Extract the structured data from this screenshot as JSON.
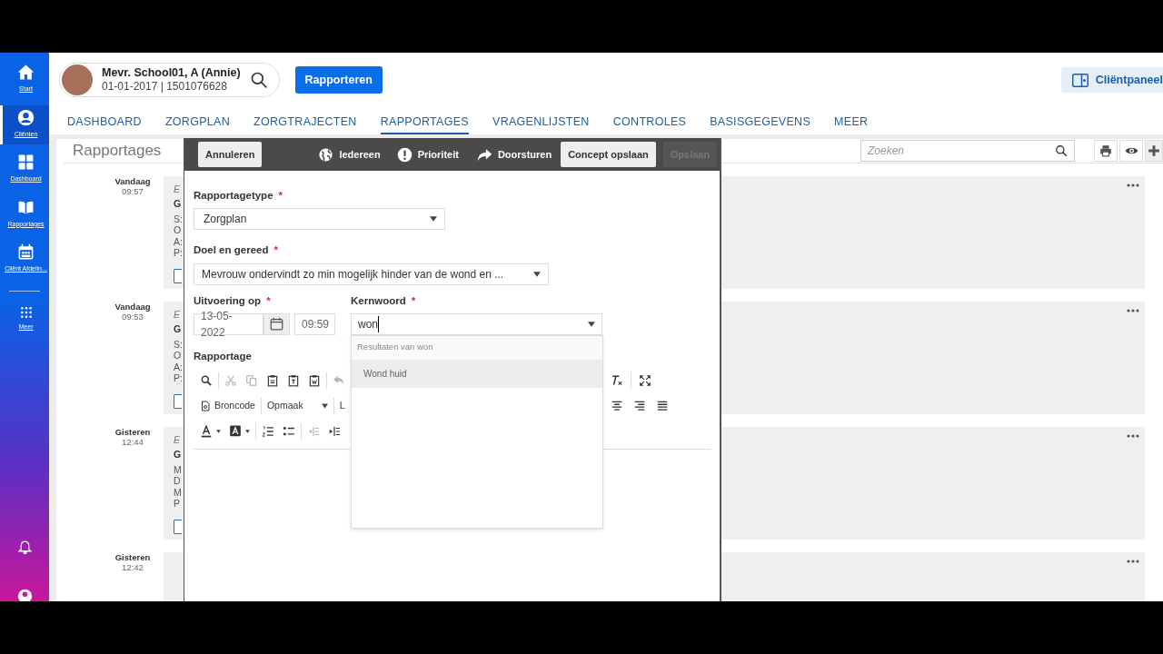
{
  "sidebar": {
    "items": [
      {
        "label": "Start",
        "selected": false
      },
      {
        "label": "Cliënten",
        "selected": true
      },
      {
        "label": "Dashboard",
        "selected": false
      },
      {
        "label": "Rapportages",
        "selected": false
      },
      {
        "label": "Cliënt Afdelin...",
        "selected": false
      },
      {
        "label": "Meer",
        "selected": false
      }
    ]
  },
  "client": {
    "name": "Mevr. School01, A (Annie)",
    "details": "01-01-2017 | 1501076628"
  },
  "report_button": "Rapporteren",
  "client_panel_button": "Cliëntpaneel",
  "tabs": [
    {
      "label": "DASHBOARD",
      "selected": false
    },
    {
      "label": "ZORGPLAN",
      "selected": false
    },
    {
      "label": "ZORGTRAJECTEN",
      "selected": false
    },
    {
      "label": "RAPPORTAGES",
      "selected": true
    },
    {
      "label": "VRAGENLIJSTEN",
      "selected": false
    },
    {
      "label": "CONTROLES",
      "selected": false
    },
    {
      "label": "BASISGEGEVENS",
      "selected": false
    },
    {
      "label": "MEER",
      "selected": false
    }
  ],
  "panel": {
    "title": "Rapportages",
    "search": {
      "placeholder": "Zoeken"
    }
  },
  "entries": [
    {
      "day": "Vandaag",
      "time": "09:57",
      "lines": [
        {
          "kind": "meta",
          "text": "E"
        },
        {
          "kind": "title",
          "text": "G"
        },
        {
          "kind": "text",
          "text": "S:"
        },
        {
          "kind": "text",
          "text": "O"
        },
        {
          "kind": "text",
          "text": "A:"
        },
        {
          "kind": "text",
          "text": "P:"
        }
      ]
    },
    {
      "day": "Vandaag",
      "time": "09:53",
      "lines": [
        {
          "kind": "meta",
          "text": "E"
        },
        {
          "kind": "title",
          "text": "G"
        },
        {
          "kind": "text",
          "text": "S:"
        },
        {
          "kind": "text",
          "text": "O"
        },
        {
          "kind": "text",
          "text": "A:"
        },
        {
          "kind": "text",
          "text": "P:"
        }
      ]
    },
    {
      "day": "Gisteren",
      "time": "12:44",
      "lines": [
        {
          "kind": "meta",
          "text": "E"
        },
        {
          "kind": "title",
          "text": "G"
        },
        {
          "kind": "text",
          "text": "M"
        },
        {
          "kind": "text",
          "text": "D"
        },
        {
          "kind": "text",
          "text": "M"
        },
        {
          "kind": "text",
          "text": "P"
        }
      ]
    },
    {
      "day": "Gisteren",
      "time": "12:42"
    }
  ],
  "modal": {
    "actions": [
      {
        "kind": "button",
        "label": "Annuleren",
        "disabled": false
      },
      {
        "kind": "link",
        "label": "Iedereen",
        "disabled": false
      },
      {
        "kind": "link",
        "label": "Prioriteit",
        "disabled": false
      },
      {
        "kind": "link",
        "label": "Doorsturen",
        "disabled": false
      },
      {
        "kind": "button",
        "label": "Concept opslaan",
        "disabled": false
      },
      {
        "kind": "button",
        "label": "Opslaan",
        "disabled": true
      }
    ],
    "report_type": {
      "label": "Rapportagetype",
      "mark": "*",
      "value": "Zorgplan"
    },
    "goal": {
      "label": "Doel en gereed",
      "mark": "*",
      "value": "Mevrouw ondervindt zo min mogelijk hinder van de wond en ..."
    },
    "execution": {
      "label": "Uitvoering op",
      "mark": "*",
      "date": "13-05-2022",
      "time": "09:59"
    },
    "keyword": {
      "label": "Kernwoord",
      "mark": "*",
      "value": "won",
      "results_header": "Resultaten van won",
      "results": [
        {
          "label": "Wond huid",
          "selected": true
        }
      ]
    },
    "editor": {
      "label": "Rapportage",
      "rows": [
        {
          "left": [
            {
              "kind": "icon",
              "disabled": false
            },
            {
              "kind": "sep"
            },
            {
              "kind": "icon",
              "disabled": true
            },
            {
              "kind": "icon",
              "disabled": true
            },
            {
              "kind": "icon",
              "disabled": false
            },
            {
              "kind": "icon",
              "disabled": false
            },
            {
              "kind": "icon",
              "disabled": false
            },
            {
              "kind": "sep"
            },
            {
              "kind": "icon",
              "disabled": true
            }
          ],
          "right": [
            {
              "kind": "icon",
              "disabled": false
            },
            {
              "kind": "sep"
            },
            {
              "kind": "icon",
              "disabled": false
            }
          ]
        },
        {
          "left": [
            {
              "kind": "text",
              "label": "Broncode",
              "disabled": false
            },
            {
              "kind": "sep"
            },
            {
              "kind": "dropdown",
              "label": "Opmaak",
              "disabled": false
            },
            {
              "kind": "sep"
            },
            {
              "kind": "plain",
              "label": "L"
            }
          ],
          "right": [
            {
              "kind": "icon",
              "disabled": false
            },
            {
              "kind": "icon",
              "disabled": false
            },
            {
              "kind": "icon",
              "disabled": false
            }
          ]
        },
        {
          "left": [
            {
              "kind": "icon",
              "disabled": false
            },
            {
              "kind": "icon",
              "disabled": false
            },
            {
              "kind": "sep"
            },
            {
              "kind": "icon",
              "disabled": false
            },
            {
              "kind": "icon",
              "disabled": false
            },
            {
              "kind": "sep"
            },
            {
              "kind": "icon",
              "disabled": true
            },
            {
              "kind": "icon",
              "disabled": false
            }
          ]
        }
      ]
    }
  }
}
